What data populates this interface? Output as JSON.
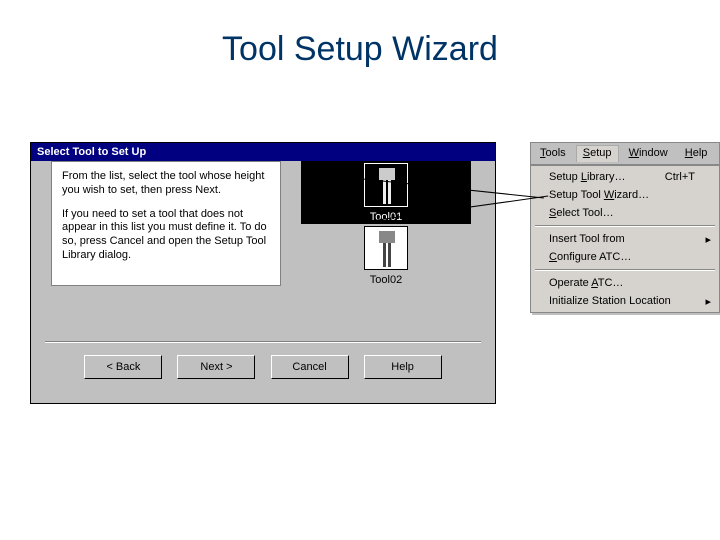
{
  "slide": {
    "title": "Tool Setup Wizard"
  },
  "wizard": {
    "title": "Select Tool to Set Up",
    "instruction1": "From the list, select the tool whose height you wish to set, then press Next.",
    "instruction2": "If you need to set a tool that does not appear in this list you must define it. To do so, press Cancel and open the Setup Tool Library dialog.",
    "tools": [
      {
        "label": "Tool01",
        "selected": true
      },
      {
        "label": "Tool02",
        "selected": false
      }
    ],
    "buttons": {
      "back": "< Back",
      "next": "Next >",
      "cancel": "Cancel",
      "help": "Help"
    }
  },
  "menubar": {
    "items": [
      {
        "label": "Tools",
        "hotkey": "T"
      },
      {
        "label": "Setup",
        "hotkey": "S",
        "open": true
      },
      {
        "label": "Window",
        "hotkey": "W"
      },
      {
        "label": "Help",
        "hotkey": "H"
      }
    ]
  },
  "dropdown": {
    "groups": [
      [
        {
          "label": "Setup Library…",
          "hotkey": "L",
          "shortcut": "Ctrl+T"
        },
        {
          "label": "Setup Tool Wizard…",
          "hotkey": "W"
        },
        {
          "label": "Select Tool…",
          "hotkey": "S"
        }
      ],
      [
        {
          "label": "Insert Tool from",
          "submenu": true
        },
        {
          "label": "Configure ATC…",
          "hotkey": "C"
        }
      ],
      [
        {
          "label": "Operate ATC…",
          "hotkey": "A"
        },
        {
          "label": "Initialize Station Location",
          "submenu": true
        }
      ]
    ]
  }
}
